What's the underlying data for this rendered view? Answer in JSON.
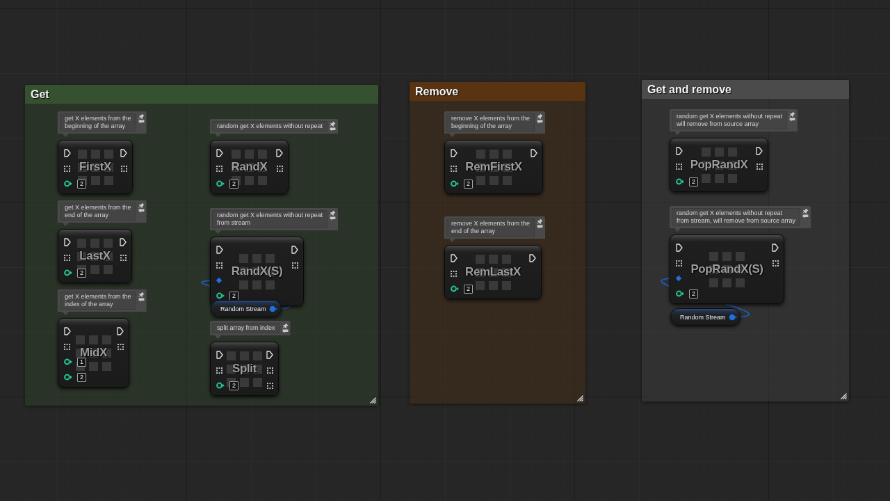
{
  "graph": {
    "comment_boxes": [
      {
        "title": "Get",
        "color": "#36512f",
        "nodes": [
          {
            "kind": "macro",
            "comment": "get X elements from the\nbeginning of the array",
            "title": "FirstX",
            "inputs": [
              {
                "kind": "exec"
              },
              {
                "kind": "array"
              },
              {
                "kind": "int",
                "value": "2"
              }
            ],
            "outputs": [
              {
                "kind": "exec"
              },
              {
                "kind": "array"
              }
            ]
          },
          {
            "kind": "macro",
            "comment": "get X elements from the\nend of the array",
            "title": "LastX",
            "inputs": [
              {
                "kind": "exec"
              },
              {
                "kind": "array"
              },
              {
                "kind": "int",
                "value": "2"
              }
            ],
            "outputs": [
              {
                "kind": "exec"
              },
              {
                "kind": "array"
              }
            ]
          },
          {
            "kind": "macro",
            "comment": "get X elements from the\nindex of the array",
            "title": "MidX",
            "inputs": [
              {
                "kind": "exec"
              },
              {
                "kind": "array"
              },
              {
                "kind": "int",
                "value": "1"
              },
              {
                "kind": "int",
                "value": "2"
              }
            ],
            "outputs": [
              {
                "kind": "exec"
              },
              {
                "kind": "array"
              }
            ]
          },
          {
            "kind": "macro",
            "comment": "random get X elements without repeat",
            "title": "RandX",
            "inputs": [
              {
                "kind": "exec"
              },
              {
                "kind": "array"
              },
              {
                "kind": "int",
                "value": "2"
              }
            ],
            "outputs": [
              {
                "kind": "exec"
              },
              {
                "kind": "array"
              }
            ]
          },
          {
            "kind": "macro",
            "comment": "random get X elements without repeat\nfrom stream",
            "title": "RandX(S)",
            "inputs": [
              {
                "kind": "exec"
              },
              {
                "kind": "array"
              },
              {
                "kind": "stream",
                "connected": true
              },
              {
                "kind": "int",
                "value": "2"
              }
            ],
            "outputs": [
              {
                "kind": "exec"
              },
              {
                "kind": "array"
              }
            ]
          },
          {
            "kind": "variable",
            "label": "Random Stream",
            "outputs": [
              {
                "kind": "stream"
              }
            ]
          },
          {
            "kind": "macro",
            "comment": "split array from index",
            "title": "Split",
            "inputs": [
              {
                "kind": "exec"
              },
              {
                "kind": "array"
              },
              {
                "kind": "int",
                "value": "2"
              }
            ],
            "outputs": [
              {
                "kind": "exec"
              },
              {
                "kind": "array"
              },
              {
                "kind": "array"
              }
            ]
          }
        ]
      },
      {
        "title": "Remove",
        "color": "#5a3412",
        "nodes": [
          {
            "kind": "macro",
            "comment": "remove X elements from the\nbeginning of the array",
            "title": "RemFirstX",
            "inputs": [
              {
                "kind": "exec"
              },
              {
                "kind": "array"
              },
              {
                "kind": "int",
                "value": "2"
              }
            ],
            "outputs": [
              {
                "kind": "exec"
              }
            ]
          },
          {
            "kind": "macro",
            "comment": "remove X elements from the\nend of the array",
            "title": "RemLastX",
            "inputs": [
              {
                "kind": "exec"
              },
              {
                "kind": "array"
              },
              {
                "kind": "int",
                "value": "2"
              }
            ],
            "outputs": [
              {
                "kind": "exec"
              }
            ]
          }
        ]
      },
      {
        "title": "Get and remove",
        "color": "#4b4b4b",
        "nodes": [
          {
            "kind": "macro",
            "comment": "random get X elements without repeat\nwill remove from source array",
            "title": "PopRandX",
            "inputs": [
              {
                "kind": "exec"
              },
              {
                "kind": "array"
              },
              {
                "kind": "int",
                "value": "2"
              }
            ],
            "outputs": [
              {
                "kind": "exec"
              },
              {
                "kind": "array"
              }
            ]
          },
          {
            "kind": "macro",
            "comment": "random get X elements without repeat\nfrom stream, will remove from source array",
            "title": "PopRandX(S)",
            "inputs": [
              {
                "kind": "exec"
              },
              {
                "kind": "array"
              },
              {
                "kind": "stream",
                "connected": true
              },
              {
                "kind": "int",
                "value": "2"
              }
            ],
            "outputs": [
              {
                "kind": "exec"
              },
              {
                "kind": "array"
              }
            ]
          },
          {
            "kind": "variable",
            "label": "Random Stream",
            "outputs": [
              {
                "kind": "stream"
              }
            ]
          }
        ]
      }
    ]
  }
}
